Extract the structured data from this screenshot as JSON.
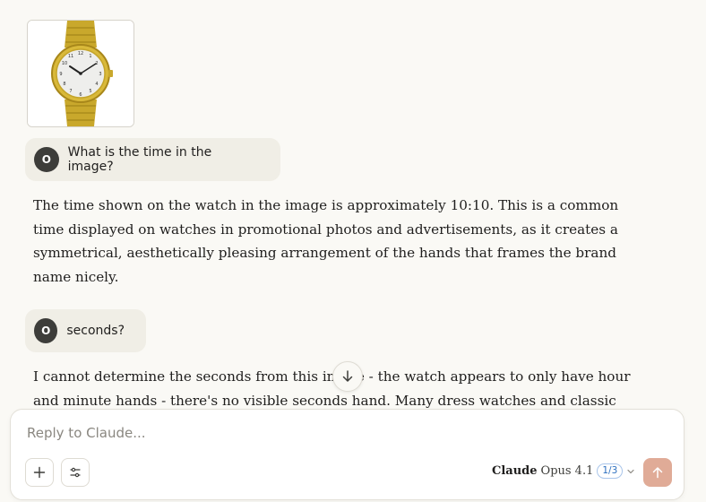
{
  "messages": [
    {
      "role": "user",
      "avatar": "O",
      "text": "What is the time in the image?"
    },
    {
      "role": "assistant",
      "text": "The time shown on the watch in the image is approximately 10:10. This is a common time displayed on watches in promotional photos and advertisements, as it creates a symmetrical, aesthetically pleasing arrangement of the hands that frames the brand name nicely."
    },
    {
      "role": "user",
      "avatar": "O",
      "text": "seconds?"
    },
    {
      "role": "assistant",
      "text": "I cannot determine the seconds from this image - the watch appears to only have hour and minute hands - there's no visible seconds hand. Many dress watches and classic style watches"
    }
  ],
  "composer": {
    "placeholder": "Reply to Claude...",
    "model_name": "Claude",
    "model_version": "Opus 4.1",
    "version_badge": "1/3"
  },
  "icons": {
    "add": "plus-icon",
    "tools": "sliders-icon",
    "send": "arrow-up-icon",
    "scroll": "arrow-down-icon",
    "dropdown": "chevron-down-icon"
  },
  "colors": {
    "background": "#faf9f5",
    "bubble": "#f0eee6",
    "avatar": "#3d3d3a",
    "send_button": "#e0ab97",
    "badge": "#2c6fbf"
  }
}
